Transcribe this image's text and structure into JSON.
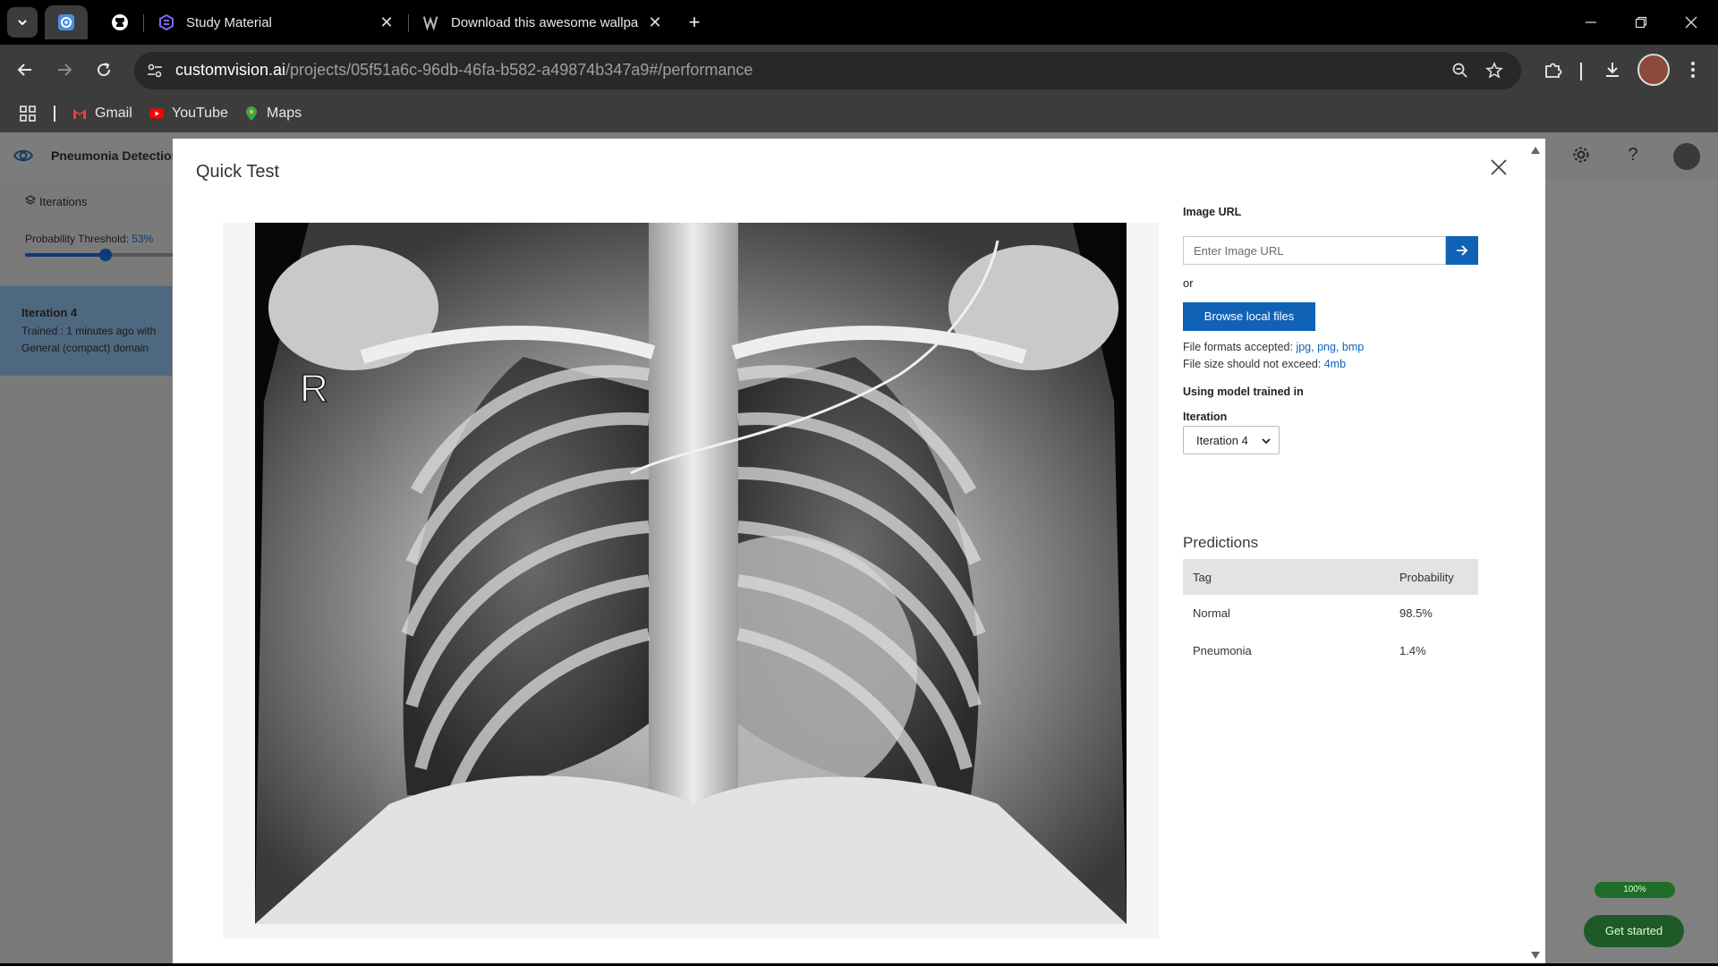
{
  "browser": {
    "tabs": [
      {
        "title": "",
        "icon": "custom-vision-icon",
        "active": true
      },
      {
        "title": "",
        "icon": "github-icon",
        "active": false
      },
      {
        "title": "Study Material",
        "icon": "study-icon",
        "active": false
      },
      {
        "title": "Download this awesome wallpa",
        "icon": "w-icon",
        "active": false
      }
    ],
    "url_host": "customvision.ai",
    "url_path": "/projects/05f51a6c-96db-46fa-b582-a49874b347a9#/performance",
    "bookmarks": [
      "Gmail",
      "YouTube",
      "Maps"
    ]
  },
  "page": {
    "project_name": "Pneumonia Detection",
    "iterations_label": "Iterations",
    "threshold_label": "Probability Threshold:",
    "threshold_value": "53%",
    "threshold_fraction": 0.53,
    "iteration_card": {
      "name": "Iteration 4",
      "meta_line1": "Trained : 1 minutes ago with",
      "meta_line2": "General (compact) domain"
    },
    "progress_pill": "100%",
    "get_started": "Get started"
  },
  "modal": {
    "title": "Quick Test",
    "image_letter": "R",
    "image_url_label": "Image URL",
    "image_url_placeholder": "Enter Image URL",
    "or_label": "or",
    "browse_label": "Browse local files",
    "formats_label": "File formats accepted: ",
    "formats": "jpg, png, bmp",
    "size_label": "File size should not exceed: ",
    "size_value": "4mb",
    "model_label": "Using model trained in",
    "iteration_label": "Iteration",
    "iteration_selected": "Iteration 4",
    "predictions_title": "Predictions",
    "table_headers": {
      "tag": "Tag",
      "probability": "Probability"
    },
    "predictions": [
      {
        "tag": "Normal",
        "probability": "98.5%"
      },
      {
        "tag": "Pneumonia",
        "probability": "1.4%"
      }
    ]
  },
  "colors": {
    "accent": "#0f62b6",
    "browser_dark": "#3c3c3c",
    "overlay_grey": "#808080",
    "success_green": "#1e6e28"
  }
}
